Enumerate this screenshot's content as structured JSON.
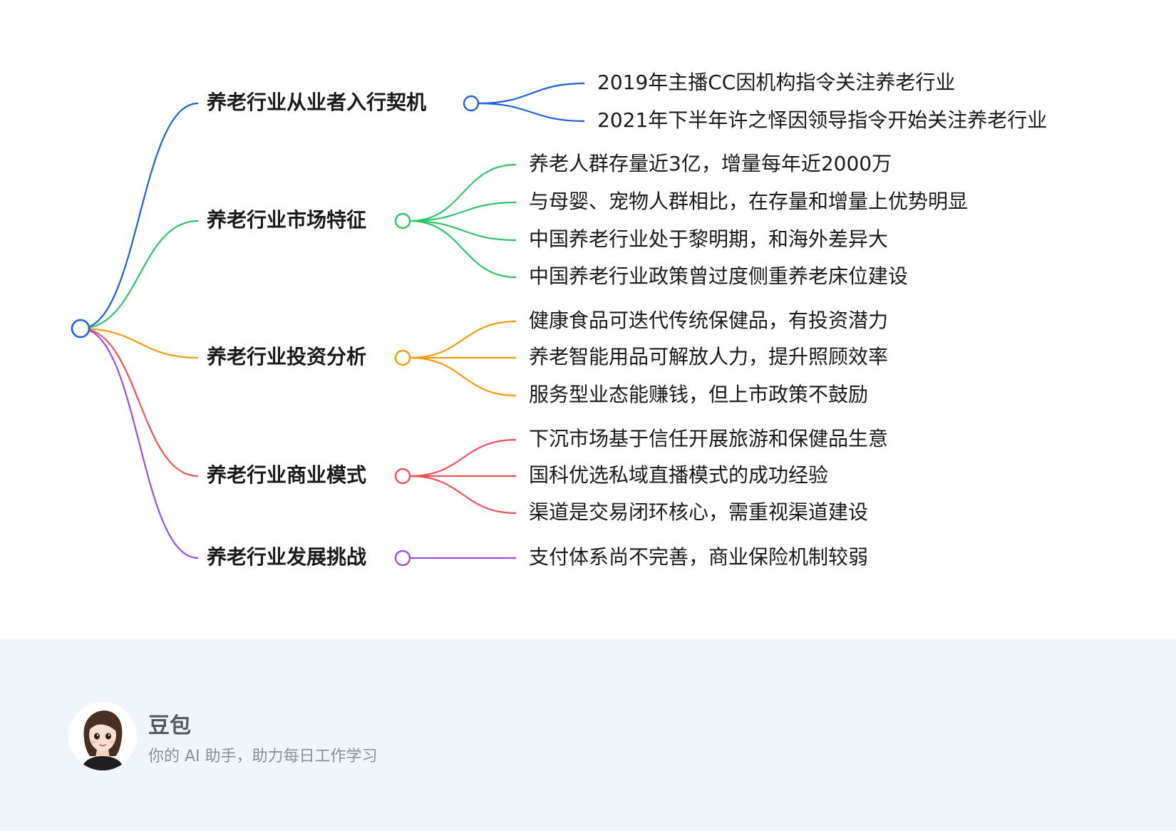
{
  "mindmap": {
    "branches": [
      {
        "label": "养老行业从业者入行契机",
        "color": "#1f5ee6",
        "children": [
          "2019年主播CC因机构指令关注养老行业",
          "2021年下半年许之怿因领导指令开始关注养老行业"
        ]
      },
      {
        "label": "养老行业市场特征",
        "color": "#2ec46a",
        "children": [
          "养老人群存量近3亿，增量每年近2000万",
          "与母婴、宠物人群相比，在存量和增量上优势明显",
          "中国养老行业处于黎明期，和海外差异大",
          "中国养老行业政策曾过度侧重养老床位建设"
        ]
      },
      {
        "label": "养老行业投资分析",
        "color": "#f59b0c",
        "children": [
          "健康食品可迭代传统保健品，有投资潜力",
          "养老智能用品可解放人力，提升照顾效率",
          "服务型业态能赚钱，但上市政策不鼓励"
        ]
      },
      {
        "label": "养老行业商业模式",
        "color": "#f0505a",
        "children": [
          "下沉市场基于信任开展旅游和保健品生意",
          "国科优选私域直播模式的成功经验",
          "渠道是交易闭环核心，需重视渠道建设"
        ]
      },
      {
        "label": "养老行业发展挑战",
        "color": "#9b4fe0",
        "children": [
          "支付体系尚不完善，商业保险机制较弱"
        ]
      }
    ],
    "root_color": "#1f5ee6"
  },
  "footer": {
    "name": "豆包",
    "tagline": "你的 AI 助手，助力每日工作学习"
  }
}
